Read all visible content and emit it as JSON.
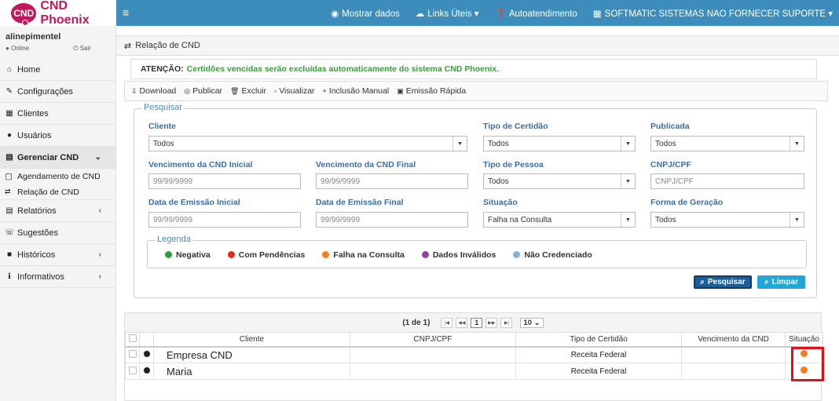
{
  "brand": {
    "logo_badge": "CND",
    "logo_text": "CND Phoenix"
  },
  "topnav": {
    "mostrar": "Mostrar dados",
    "links": "Links Úteis",
    "auto": "Autoatendimento",
    "company": "SOFTMATIC SISTEMAS NAO FORNECER SUPORTE"
  },
  "user": {
    "name": "alinepimentel",
    "status": "Online",
    "logout": "Sair"
  },
  "sidebar": {
    "items": [
      "Home",
      "Configurações",
      "Clientes",
      "Usuários",
      "Gerenciar CND",
      "Relatórios",
      "Sugestões",
      "Históricos",
      "Informativos"
    ],
    "subitems": [
      "Agendamento de CND",
      "Relação de CND"
    ]
  },
  "page": {
    "title": "Relação de CND",
    "alert_label": "ATENÇÃO:",
    "alert_text": "Certidões vencidas serão excluídas automaticamente do sistema CND Phoenix."
  },
  "toolbar": [
    "Download",
    "Publicar",
    "Excluir",
    "Visualizar",
    "Inclusão Manual",
    "Emissão Rápida"
  ],
  "search": {
    "legend": "Pesquisar",
    "cliente_label": "Cliente",
    "cliente_value": "Todos",
    "tipo_cert_label": "Tipo de Certidão",
    "tipo_cert_value": "Todos",
    "publicada_label": "Publicada",
    "publicada_value": "Todos",
    "venc_ini_label": "Vencimento da CND Inicial",
    "venc_ini_ph": "99/99/9999",
    "venc_fim_label": "Vencimento da CND Final",
    "venc_fim_ph": "99/99/9999",
    "tipo_pessoa_label": "Tipo de Pessoa",
    "tipo_pessoa_value": "Todos",
    "cnpj_label": "CNPJ/CPF",
    "cnpj_ph": "CNPJ/CPF",
    "em_ini_label": "Data de Emissão Inicial",
    "em_ini_ph": "99/99/9999",
    "em_fim_label": "Data de Emissão Final",
    "em_fim_ph": "99/99/9999",
    "situacao_label": "Situação",
    "situacao_value": "Falha na Consulta",
    "forma_label": "Forma de Geração",
    "forma_value": "Todos",
    "pesquisar_btn": "Pesquisar",
    "limpar_btn": "Limpar"
  },
  "legend": {
    "title": "Legenda",
    "items": [
      {
        "label": "Negativa",
        "color": "#2e9e3e"
      },
      {
        "label": "Com Pendências",
        "color": "#e02a1a"
      },
      {
        "label": "Falha na Consulta",
        "color": "#f0811e"
      },
      {
        "label": "Dados Inválidos",
        "color": "#9b3fa6"
      },
      {
        "label": "Não Credenciado",
        "color": "#7fb3d9"
      }
    ]
  },
  "pager": {
    "info": "(1 de 1)",
    "page": "1",
    "per_page": "10"
  },
  "table": {
    "columns": [
      "Cliente",
      "CNPJ/CPF",
      "Tipo de Certidão",
      "Vencimento da CND",
      "Situação"
    ],
    "rows": [
      {
        "cliente": "Empresa CND",
        "cnpj": "",
        "tipo": "Receita Federal",
        "venc": "",
        "situacao_color": "#f0811e"
      },
      {
        "cliente": "Maria",
        "cnpj": "",
        "tipo": "Receita Federal",
        "venc": "",
        "situacao_color": "#f0811e"
      }
    ]
  }
}
